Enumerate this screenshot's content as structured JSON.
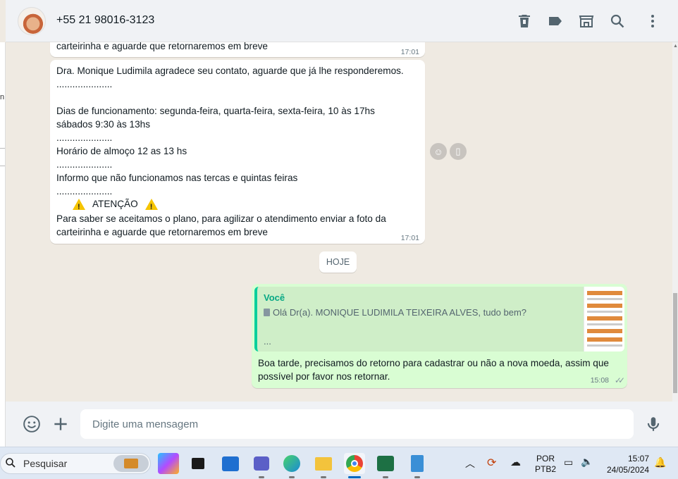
{
  "header": {
    "contact_name": "+55 21 98016-3123",
    "icons": [
      "delete-icon",
      "label-icon",
      "catalog-icon",
      "search-icon",
      "menu-icon"
    ]
  },
  "messages": {
    "top_partial": {
      "text": "carteirinha e aguarde que retornaremos em breve",
      "time": "17:01"
    },
    "main_incoming": {
      "lines": [
        "Dra. Monique Ludimila agradece seu contato, aguarde que já lhe responderemos.",
        ".....................",
        "",
        "Dias de funcionamento: segunda-feira, quarta-feira, sexta-feira, 10 às 17hs",
        "sábados  9:30 às 13hs",
        ".....................",
        "Horário de almoço 12 as 13 hs",
        ".....................",
        "Informo que não funcionamos nas tercas e quintas feiras",
        "....................."
      ],
      "attention": "ATENÇÃO",
      "closing": "Para saber se aceitamos  o plano, para agilizar o atendimento enviar a foto da\ncarteirinha e aguarde que retornaremos em breve",
      "time": "17:01"
    },
    "day_divider": "HOJE",
    "outgoing": {
      "quote_author": "Você",
      "quote_text": "Olá Dr(a). MONIQUE LUDIMILA TEIXEIRA ALVES, tudo bem?",
      "quote_ellipsis": "...",
      "text": "Boa tarde, precisamos do retorno para cadastrar ou não a nova moeda, assim que possível por favor nos retornar.",
      "time": "15:08"
    }
  },
  "composer": {
    "placeholder": "Digite uma mensagem"
  },
  "taskbar": {
    "search_label": "Pesquisar",
    "apps": [
      "copilot-icon",
      "task-view-icon",
      "store-icon",
      "teams-icon",
      "edge-icon",
      "file-explorer-icon",
      "chrome-icon",
      "excel-icon",
      "notepad-icon"
    ],
    "language_top": "POR",
    "language_bottom": "PTB2",
    "clock_time": "15:07",
    "clock_date": "24/05/2024"
  },
  "colors": {
    "chat_bg": "#efeae2",
    "outgoing_bubble": "#d9fdd3",
    "quote_accent": "#06cf9c",
    "quote_author": "#06a884"
  }
}
